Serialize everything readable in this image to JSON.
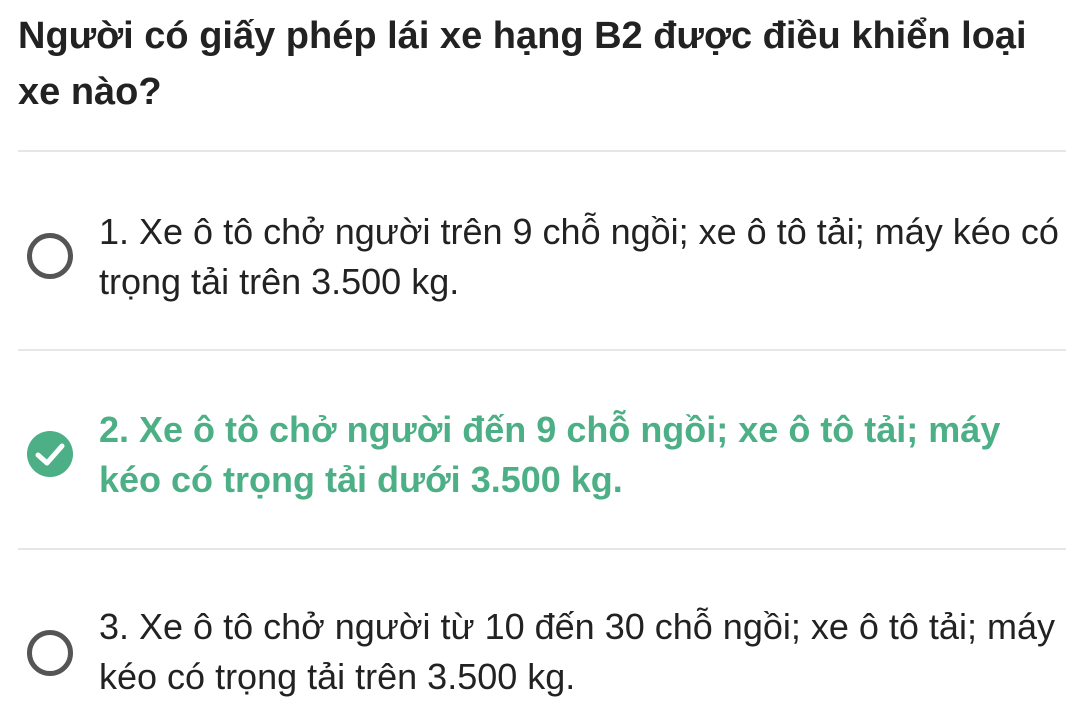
{
  "question": {
    "text": "Người có giấy phép lái xe hạng B2 được điều khiển loại xe nào?"
  },
  "answers": [
    {
      "text": "1. Xe ô tô chở người trên 9 chỗ ngồi; xe ô tô tải; máy kéo có trọng tải trên 3.500 kg.",
      "selected": false,
      "correct": false
    },
    {
      "text": "2. Xe ô tô chở người đến 9 chỗ ngồi; xe ô tô tải; máy kéo có trọng tải dưới 3.500 kg.",
      "selected": true,
      "correct": true
    },
    {
      "text": "3. Xe ô tô chở người từ 10 đến 30 chỗ ngồi; xe ô tô tải; máy kéo có trọng tải trên 3.500 kg.",
      "selected": false,
      "correct": false
    }
  ],
  "colors": {
    "correct": "#4caf86",
    "text": "#222222",
    "radio_border": "#555555",
    "divider": "#e6e6e6"
  },
  "icons": {
    "unselected": "radio-empty-icon",
    "selected": "check-circle-icon"
  }
}
